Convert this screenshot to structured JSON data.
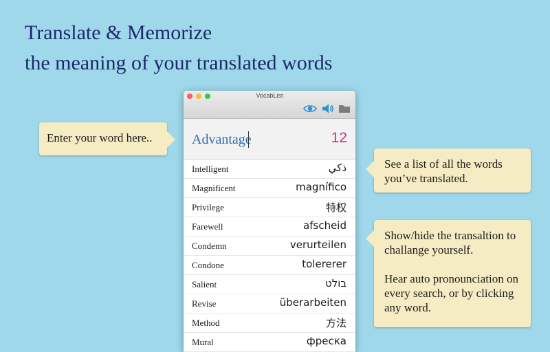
{
  "headline": {
    "line1": "Translate & Memorize",
    "line2": "the meaning of your translated words"
  },
  "callouts": {
    "input_hint": "Enter your word here..",
    "list_hint": "See a list of all the words you’ve translated.",
    "toggle_hint": "Show/hide the transaltion to challange yourself.",
    "audio_hint": "Hear auto pronounciation on every search, or by clicking any word."
  },
  "window": {
    "title": "VocabList",
    "toolbar_icons": [
      "eye-icon",
      "speaker-icon",
      "folder-icon"
    ]
  },
  "search": {
    "value": "Advantage",
    "count": "12"
  },
  "words": [
    {
      "word": "Intelligent",
      "translation": "ذكي"
    },
    {
      "word": "Magnificent",
      "translation": "magnífico"
    },
    {
      "word": "Privilege",
      "translation": "特权"
    },
    {
      "word": "Farewell",
      "translation": "afscheid"
    },
    {
      "word": "Condemn",
      "translation": "verurteilen"
    },
    {
      "word": "Condone",
      "translation": "tolererer"
    },
    {
      "word": "Salient",
      "translation": "בולט"
    },
    {
      "word": "Revise",
      "translation": "überarbeiten"
    },
    {
      "word": "Method",
      "translation": "方法"
    },
    {
      "word": "Mural",
      "translation": "фреска"
    }
  ],
  "colors": {
    "background": "#9ed8ea",
    "headline": "#1a2a6a",
    "callout": "#f5ecc4",
    "search_text": "#2f6fb1",
    "count": "#d4327f"
  }
}
